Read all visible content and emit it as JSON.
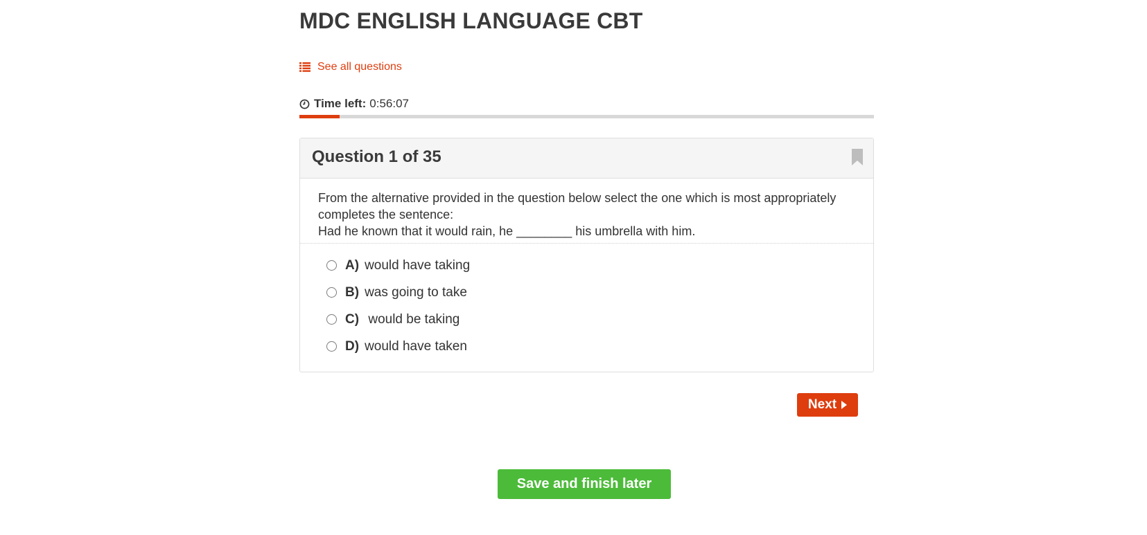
{
  "page": {
    "title": "MDC ENGLISH LANGUAGE CBT"
  },
  "nav": {
    "see_all_label": "See all questions",
    "icon": "list-icon"
  },
  "timer": {
    "label": "Time left:",
    "value": "0:56:07",
    "icon": "clock-icon",
    "progress_fraction": 0.07
  },
  "question": {
    "header": "Question 1 of 35",
    "bookmark_icon": "bookmark-icon",
    "text_line1": "From the alternative provided in the question below select the one which is most appropriately completes the sentence:",
    "text_line2": "Had he known that it would rain, he ________ his umbrella with him.",
    "options": [
      {
        "letter": "A)",
        "text": "would have taking"
      },
      {
        "letter": "B)",
        "text": "was going to take"
      },
      {
        "letter": "C)",
        "text": " would be taking"
      },
      {
        "letter": "D)",
        "text": "would have taken"
      }
    ]
  },
  "buttons": {
    "next_label": "Next",
    "save_label": "Save and finish later"
  },
  "colors": {
    "accent": "#de3d0e",
    "save_green": "#4cbb3a",
    "progress_track": "#d8d8d8"
  }
}
